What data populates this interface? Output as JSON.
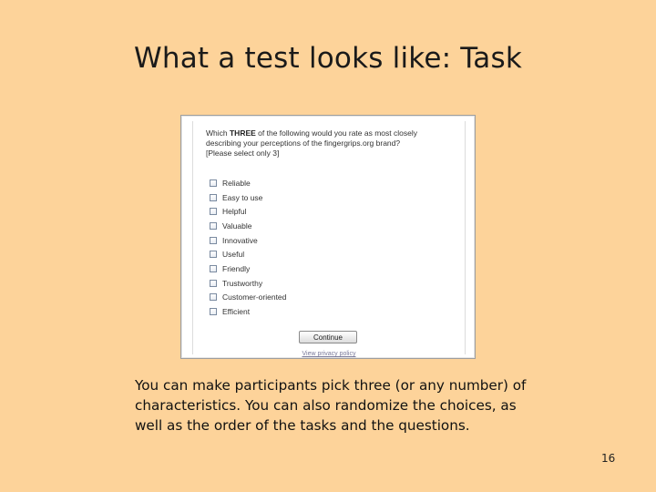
{
  "slide": {
    "title": "What a test looks like: Task",
    "description": "You can make participants pick three (or any number) of characteristics. You can also randomize the choices, as well as the order of the tasks and the questions.",
    "page_number": "16"
  },
  "survey": {
    "question_prefix": "Which ",
    "question_emphasis": "THREE",
    "question_rest": " of the following would you rate as most closely describing your perceptions of the fingergrips.org brand?",
    "question_hint": "[Please select only 3]",
    "options": [
      {
        "label": "Reliable",
        "checked": false
      },
      {
        "label": "Easy to use",
        "checked": false
      },
      {
        "label": "Helpful",
        "checked": false
      },
      {
        "label": "Valuable",
        "checked": false
      },
      {
        "label": "Innovative",
        "checked": false
      },
      {
        "label": "Useful",
        "checked": false
      },
      {
        "label": "Friendly",
        "checked": false
      },
      {
        "label": "Trustworthy",
        "checked": false
      },
      {
        "label": "Customer-oriented",
        "checked": false
      },
      {
        "label": "Efficient",
        "checked": false
      }
    ],
    "continue_label": "Continue",
    "privacy_link": "View privacy policy"
  }
}
